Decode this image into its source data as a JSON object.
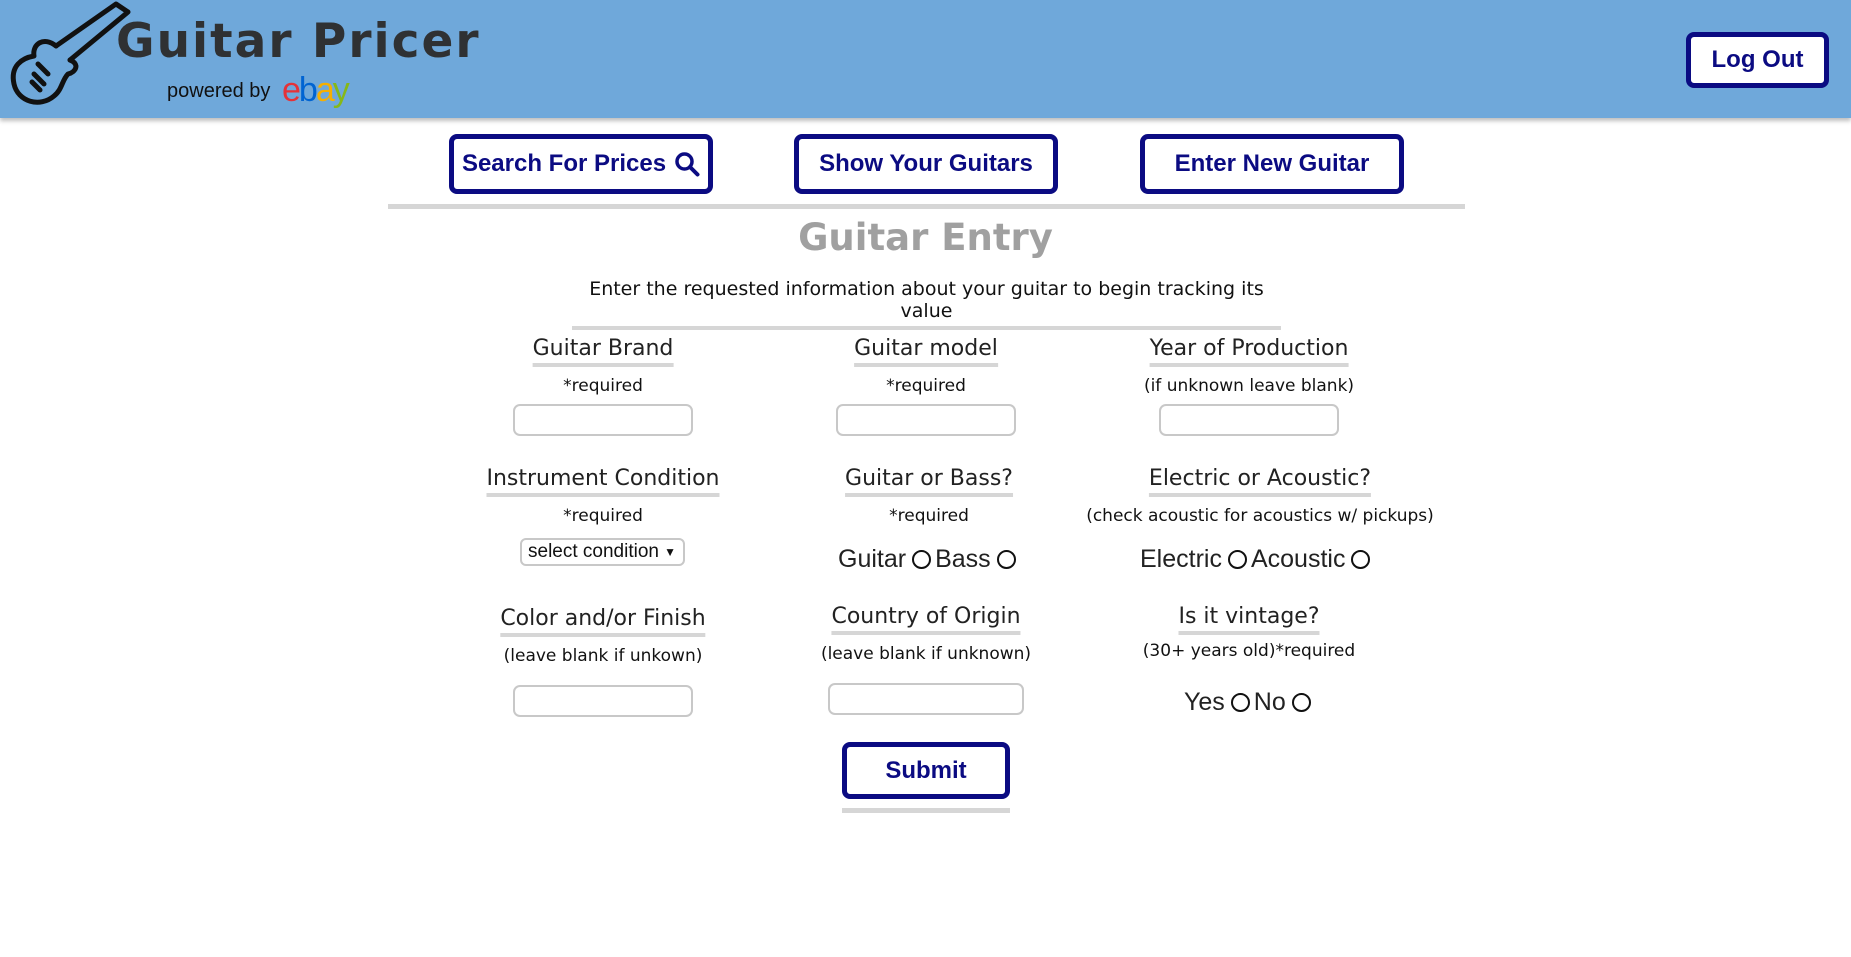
{
  "header": {
    "app_title": "Guitar Pricer",
    "powered_by": "powered by",
    "ebay_letters": [
      "e",
      "b",
      "a",
      "y"
    ],
    "logo_icon": "guitar-icon",
    "logout_label": "Log Out"
  },
  "nav": {
    "search_label": "Search For Prices",
    "search_icon": "search-icon",
    "show_label": "Show Your Guitars",
    "enter_label": "Enter New Guitar"
  },
  "page": {
    "title": "Guitar Entry",
    "subtitle": "Enter the requested information about your guitar to begin tracking its value"
  },
  "form": {
    "brand": {
      "label": "Guitar Brand",
      "note": "*required",
      "value": ""
    },
    "model": {
      "label": "Guitar model",
      "note": "*required",
      "value": ""
    },
    "year": {
      "label": "Year of Production",
      "note": "(if unknown leave blank)",
      "value": ""
    },
    "condition": {
      "label": "Instrument Condition",
      "note": "*required",
      "selected": "select condition"
    },
    "type": {
      "label": "Guitar or Bass?",
      "note": "*required",
      "options": [
        "Guitar",
        "Bass"
      ]
    },
    "electric": {
      "label": "Electric or Acoustic?",
      "note": "(check acoustic for acoustics w/ pickups)",
      "options": [
        "Electric",
        "Acoustic"
      ]
    },
    "color": {
      "label": "Color and/or Finish",
      "note": "(leave blank if unkown)",
      "value": ""
    },
    "country": {
      "label": "Country of Origin",
      "note": "(leave blank if unknown)",
      "value": ""
    },
    "vintage": {
      "label": "Is it vintage?",
      "note": "(30+ years old)*required",
      "options": [
        "Yes",
        "No"
      ]
    },
    "submit_label": "Submit"
  },
  "colors": {
    "header_bg": "#6fa8da",
    "button_border": "#0b0b82",
    "title_gray": "#a0a0a0"
  }
}
